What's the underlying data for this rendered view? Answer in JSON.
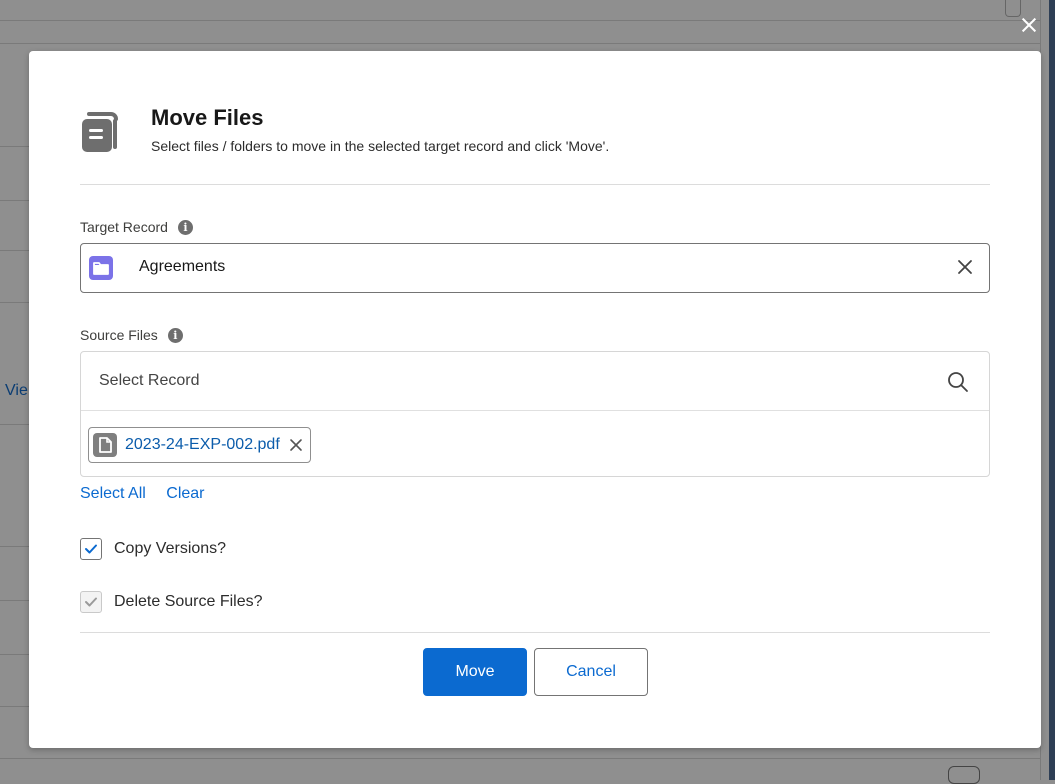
{
  "background": {
    "partial_link_text": "Vie"
  },
  "modal": {
    "title": "Move Files",
    "subtitle": "Select files / folders to move in the selected target record and click 'Move'.",
    "target_record": {
      "label": "Target Record",
      "value": "Agreements",
      "icon": "folder-icon"
    },
    "source_files": {
      "label": "Source Files",
      "search_placeholder": "Select Record",
      "selected": [
        {
          "name": "2023-24-EXP-002.pdf",
          "icon": "document-icon"
        }
      ]
    },
    "links": {
      "select_all": "Select All",
      "clear": "Clear"
    },
    "options": {
      "copy_versions": {
        "label": "Copy Versions?",
        "checked": true
      },
      "delete_source": {
        "label": "Delete Source Files?",
        "checked": true,
        "disabled": true
      }
    },
    "buttons": {
      "move": "Move",
      "cancel": "Cancel"
    }
  },
  "colors": {
    "brand": "#0b6ad0",
    "folder_icon_bg": "#7b72e8",
    "overlay": "#8f8f8f"
  }
}
